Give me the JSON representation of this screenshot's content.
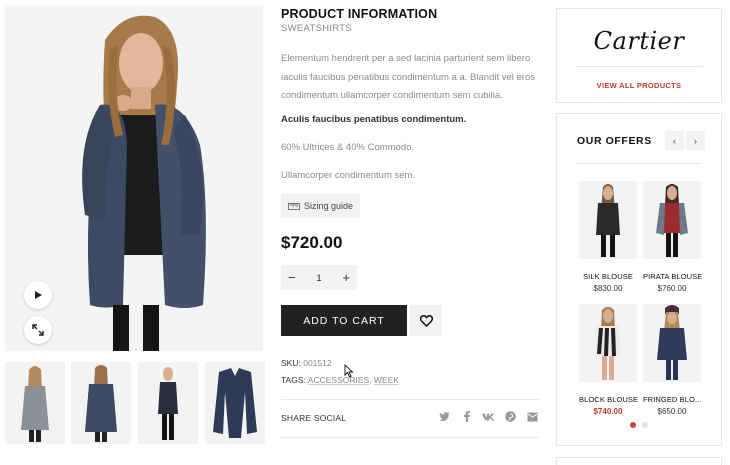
{
  "product": {
    "title": "PRODUCT INFORMATION",
    "category": "SWEATSHIRTS",
    "description": "Elementum hendrerit per a sed lacinia parturient sem libero iaculis faucibus penatibus condimentum a a. Blandit vel eros condimentum ullamcorper condimentum sem cubilia.",
    "highlight": "Aculis faucibus penatibus condimentum.",
    "composition": "60% Ultrices & 40% Commodo.",
    "note": "Ullamcorper condimentum sem.",
    "sizing_label": "Sizing guide",
    "price": "$720.00",
    "quantity": "1",
    "add_to_cart": "ADD TO CART",
    "sku_label": "SKU:",
    "sku_value": "001512",
    "tags_label": "TAGS:",
    "tags": [
      "ACCESSORIES",
      "WEEK"
    ],
    "share_label": "SHARE SOCIAL",
    "social_icons": [
      "twitter-icon",
      "facebook-icon",
      "vk-icon",
      "pinterest-icon",
      "mail-icon"
    ]
  },
  "gallery": {
    "main_color": "#3d4a63",
    "thumbnails": [
      "grey-cardigan",
      "navy-cardigan-back",
      "dark-outfit",
      "navy-cardigan-flat"
    ]
  },
  "brand": {
    "name": "Cartier",
    "link": "VIEW ALL PRODUCTS"
  },
  "offers": {
    "title": "OUR OFFERS",
    "items": [
      {
        "name": "SILK BLOUSE",
        "price": "$830.00",
        "sale": false
      },
      {
        "name": "PIRATA BLOUSE",
        "price": "$760.00",
        "sale": false
      },
      {
        "name": "BLOCK BLOUSE",
        "price": "$740.00",
        "sale": true
      },
      {
        "name": "FRINGED BLO...",
        "price": "$650.00",
        "sale": false
      }
    ],
    "dots": 2,
    "active_dot": 0
  },
  "colors": {
    "accent": "#c0392b",
    "button": "#222222",
    "cardigan": "#3d4a63"
  }
}
